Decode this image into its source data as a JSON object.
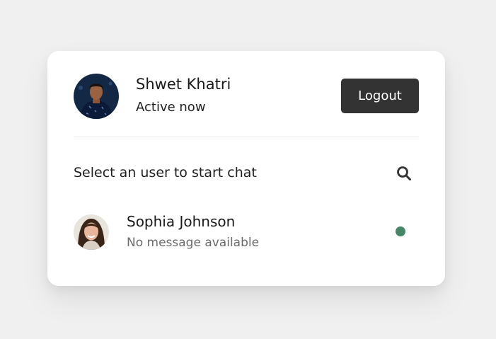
{
  "current_user": {
    "name": "Shwet Khatri",
    "status": "Active now"
  },
  "header": {
    "logout_label": "Logout"
  },
  "search": {
    "prompt": "Select an user to start chat",
    "icon": "search-icon"
  },
  "users": [
    {
      "name": "Sophia Johnson",
      "message": "No message available",
      "online": true
    }
  ],
  "colors": {
    "background": "#f0f0f0",
    "card": "#ffffff",
    "button": "#333333",
    "online_dot": "#468669",
    "muted_text": "#6b6b6b"
  }
}
